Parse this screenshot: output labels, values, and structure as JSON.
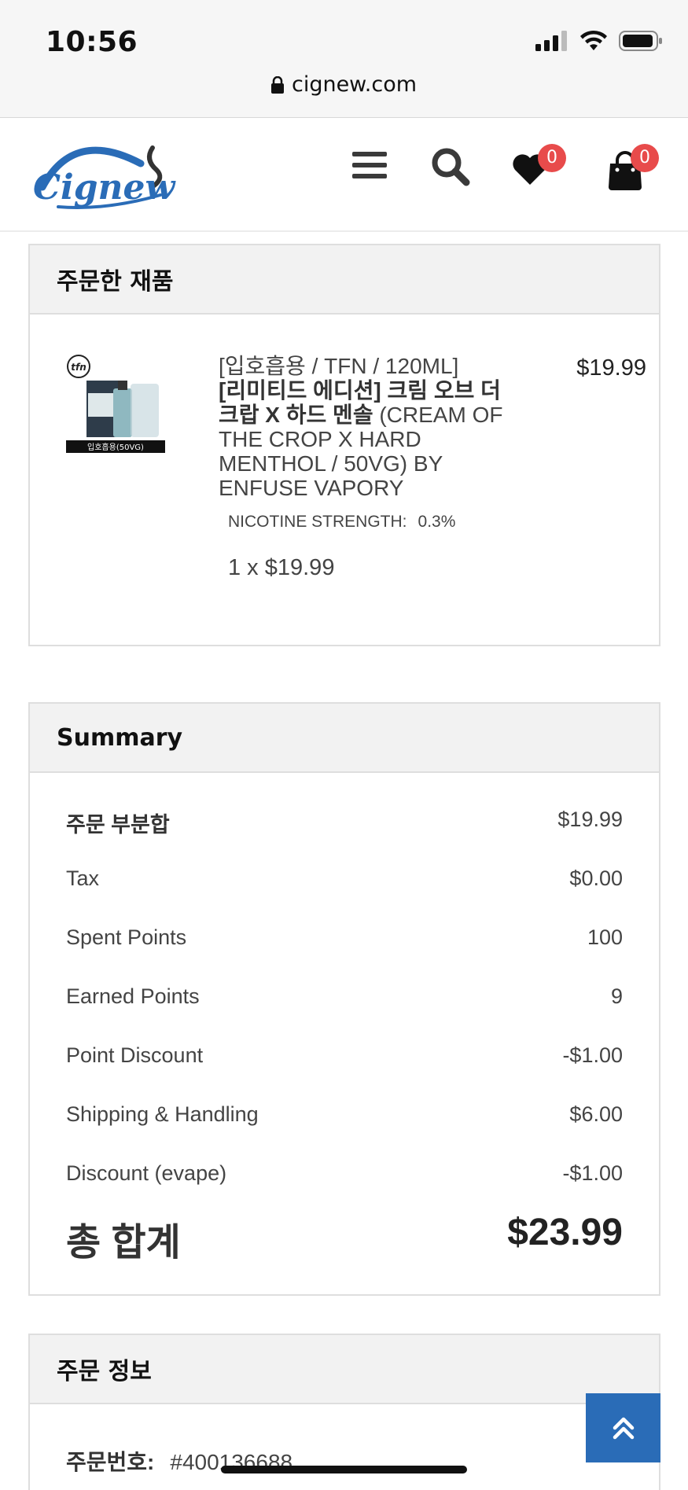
{
  "status_bar": {
    "time": "10:56"
  },
  "browser": {
    "url": "cignew.com"
  },
  "header": {
    "logo_text": "Cignew",
    "wishlist_count": "0",
    "cart_count": "0"
  },
  "products_panel": {
    "title": "주문한 재품",
    "item": {
      "image_caption": "입호흡용(50VG)",
      "name_line1": "[입호흡용 / TFN / 120ML]",
      "name_bold": "[리미티드 에디션] 크림 오브 더 크랍 X 하드 멘솔",
      "name_rest": " (CREAM OF THE CROP X HARD MENTHOL / 50VG) BY ENFUSE VAPORY",
      "price": "$19.99",
      "nicotine_label": "NICOTINE STRENGTH:",
      "nicotine_value": "0.3%",
      "qty_line": "1 x $19.99"
    }
  },
  "summary_panel": {
    "title": "Summary",
    "rows": [
      {
        "label": "주문 부분합",
        "value": "$19.99"
      },
      {
        "label": "Tax",
        "value": "$0.00"
      },
      {
        "label": "Spent Points",
        "value": "100"
      },
      {
        "label": "Earned Points",
        "value": "9"
      },
      {
        "label": "Point Discount",
        "value": "-$1.00"
      },
      {
        "label": "Shipping & Handling",
        "value": "$6.00"
      },
      {
        "label": "Discount (evape)",
        "value": "-$1.00"
      }
    ],
    "total_label": "총 합계",
    "total_value": "$23.99"
  },
  "order_info_panel": {
    "title": "주문 정보",
    "order_number_label": "주문번호:",
    "order_number_value": "#400136688"
  },
  "colors": {
    "accent": "#2a6cb7",
    "badge": "#e84b4b"
  }
}
